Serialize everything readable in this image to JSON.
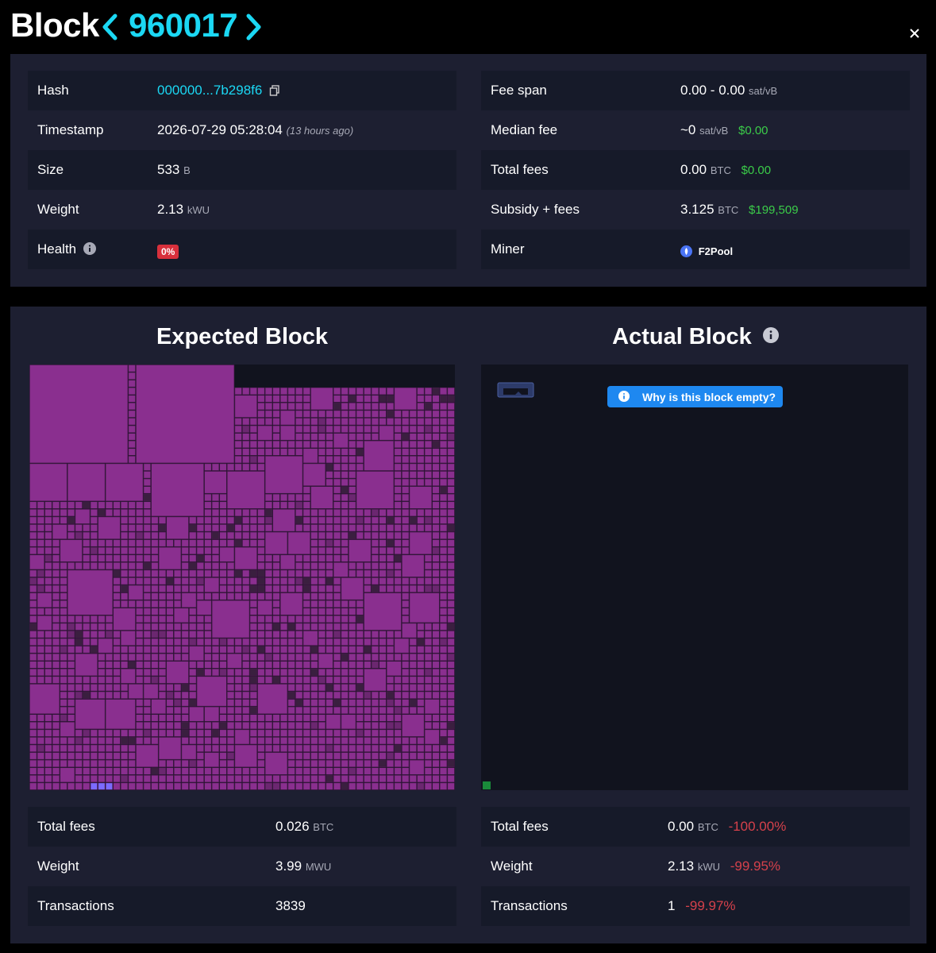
{
  "header": {
    "title": "Block",
    "height": "960017"
  },
  "details": {
    "left": [
      {
        "label": "Hash",
        "value": "000000...7b298f6"
      },
      {
        "label": "Timestamp",
        "value": "2026-07-29 05:28:04",
        "note": "(13 hours ago)"
      },
      {
        "label": "Size",
        "value": "533",
        "unit": "B"
      },
      {
        "label": "Weight",
        "value": "2.13",
        "unit": "kWU"
      },
      {
        "label": "Health",
        "badge": "0%"
      }
    ],
    "right": [
      {
        "label": "Fee span",
        "value": "0.00 - 0.00",
        "unit": "sat/vB"
      },
      {
        "label": "Median fee",
        "value": "~0",
        "unit": "sat/vB",
        "fiat": "$0.00"
      },
      {
        "label": "Total fees",
        "value": "0.00",
        "unit": "BTC",
        "fiat": "$0.00"
      },
      {
        "label": "Subsidy + fees",
        "value": "3.125",
        "unit": "BTC",
        "fiat": "$199,509"
      },
      {
        "label": "Miner",
        "value": "F2Pool"
      }
    ]
  },
  "expected": {
    "title": "Expected Block",
    "stats": [
      {
        "label": "Total fees",
        "value": "0.026",
        "unit": "BTC"
      },
      {
        "label": "Weight",
        "value": "3.99",
        "unit": "MWU"
      },
      {
        "label": "Transactions",
        "value": "3839"
      }
    ]
  },
  "actual": {
    "title": "Actual Block",
    "empty_button": "Why is this block empty?",
    "stats": [
      {
        "label": "Total fees",
        "value": "0.00",
        "unit": "BTC",
        "delta": "-100.00%"
      },
      {
        "label": "Weight",
        "value": "2.13",
        "unit": "kWU",
        "delta": "-99.95%"
      },
      {
        "label": "Transactions",
        "value": "1",
        "delta": "-99.97%"
      }
    ]
  },
  "colors": {
    "accent": "#1bd8f4",
    "panel": "#1d1f31",
    "row_alt": "#161a29",
    "tx_fill": "#8a2f8f",
    "positive": "#3bcc49",
    "negative": "#d5414b",
    "button": "#1e88f0",
    "badge": "#d8303c"
  },
  "icons": {
    "prev": "chevron-left-icon",
    "next": "chevron-right-icon",
    "close": "close-icon",
    "copy": "copy-icon",
    "info": "info-icon",
    "miner": "f2pool-logo-icon"
  }
}
